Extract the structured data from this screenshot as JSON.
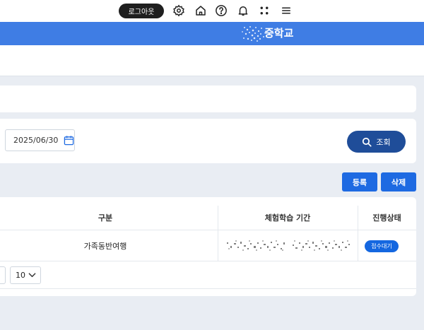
{
  "header": {
    "logout_label": "로그아웃",
    "icons": [
      "gear-icon",
      "home-icon",
      "help-icon",
      "bell-icon",
      "apps-icon",
      "menu-icon"
    ]
  },
  "banner": {
    "school_name": "중학교",
    "color": "#3f7de4"
  },
  "filters": {
    "end_date": "2025/06/30",
    "search_label": "조회"
  },
  "actions": {
    "register_label": "등록",
    "delete_label": "삭제"
  },
  "table": {
    "columns": [
      "구분",
      "체험학습 기간",
      "진행상태"
    ],
    "rows": [
      {
        "type": "가족동반여행",
        "status": "접수대기"
      }
    ]
  },
  "pagination": {
    "page_size": "10"
  },
  "colors": {
    "primary": "#1e6ae2",
    "search_button": "#1f4d99",
    "status_badge": "#1467e0"
  }
}
